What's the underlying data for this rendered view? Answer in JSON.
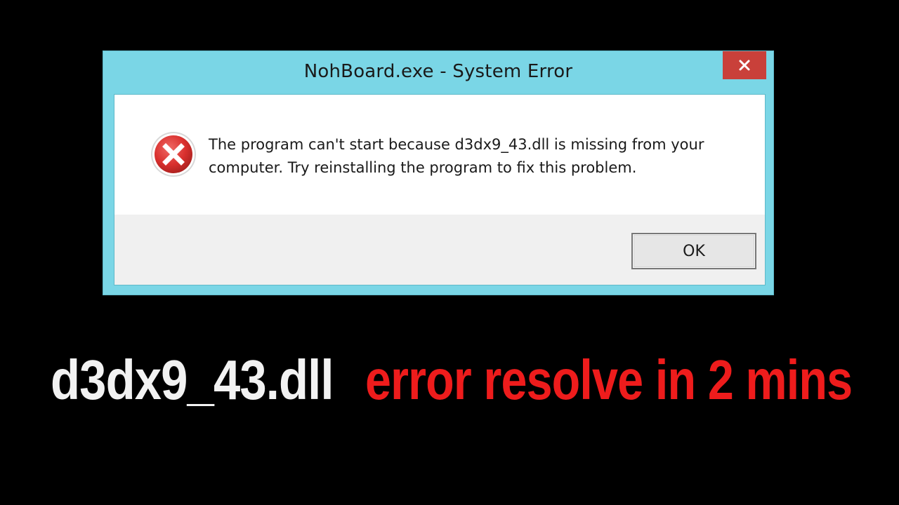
{
  "dialog": {
    "title": "NohBoard.exe - System Error",
    "close_label": "✕",
    "icon": "error-icon",
    "message": "The program can't start because d3dx9_43.dll is missing from your computer. Try reinstalling the program to fix this problem.",
    "ok_label": "OK"
  },
  "caption": {
    "filename": "d3dx9_43.dll",
    "tagline": "error resolve in 2 mins"
  },
  "colors": {
    "background": "#000000",
    "frame": "#7ad6e6",
    "close_button": "#c9403a",
    "error_icon": "#d9302e",
    "caption_white": "#f2f2f2",
    "caption_red": "#ee1c1c"
  }
}
